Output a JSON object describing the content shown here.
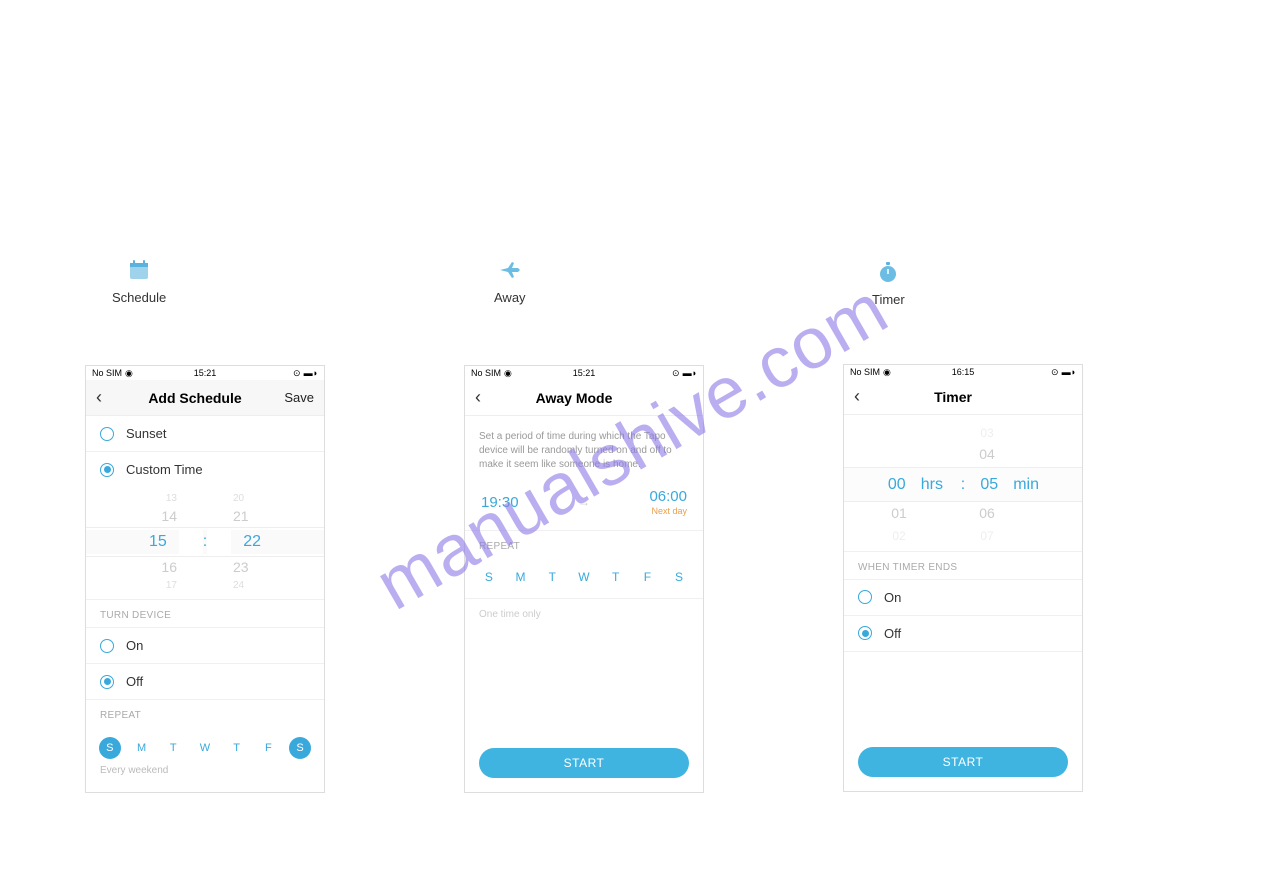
{
  "watermark": "manualshive.com",
  "icons": {
    "schedule": "Schedule",
    "away": "Away",
    "timer": "Timer"
  },
  "statusbar": {
    "no_sim": "No SIM",
    "time_1521": "15:21",
    "time_1615": "16:15"
  },
  "schedule_screen": {
    "title": "Add Schedule",
    "save": "Save",
    "sunset": "Sunset",
    "custom_time": "Custom Time",
    "picker": {
      "r0a": "13",
      "r0b": "20",
      "r1a": "14",
      "r1b": "21",
      "r2a": "15",
      "r2b": "22",
      "r3a": "16",
      "r3b": "23",
      "r4a": "17",
      "r4b": "24"
    },
    "turn_device": "TURN DEVICE",
    "on": "On",
    "off": "Off",
    "repeat": "REPEAT",
    "days": [
      "S",
      "M",
      "T",
      "W",
      "T",
      "F",
      "S"
    ],
    "summary": "Every weekend"
  },
  "away_screen": {
    "title": "Away Mode",
    "desc": "Set a period of time during which the Tapo device will be randomly turned on and off to make it seem like someone is home.",
    "start_time": "19:30",
    "end_time": "06:00",
    "next_day": "Next day",
    "repeat": "REPEAT",
    "days": [
      "S",
      "M",
      "T",
      "W",
      "T",
      "F",
      "S"
    ],
    "one_time": "One time only",
    "start": "START"
  },
  "timer_screen": {
    "title": "Timer",
    "picker": {
      "r0a": "",
      "r0b": "03",
      "r1a": "",
      "r1b": "04",
      "r2a": "00",
      "r2b": "05",
      "r3a": "01",
      "r3b": "06",
      "r4a": "02",
      "r4b": "07",
      "hrs": "hrs",
      "min": "min",
      "colon": ":"
    },
    "when_ends": "WHEN TIMER ENDS",
    "on": "On",
    "off": "Off",
    "start": "START"
  }
}
